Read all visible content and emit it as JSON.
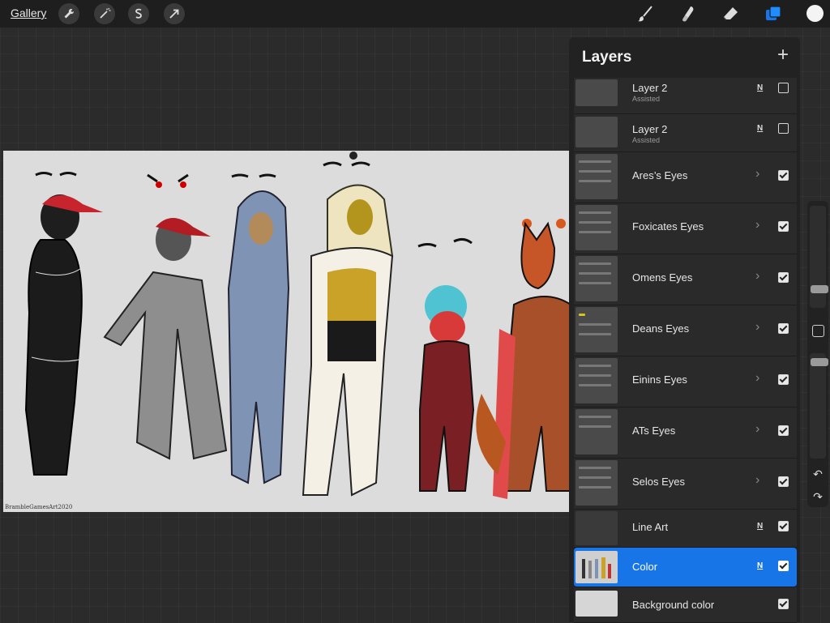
{
  "toolbar": {
    "gallery_label": "Gallery",
    "left_icons": [
      "wrench-icon",
      "magic-wand-icon",
      "selection-s-icon",
      "transform-arrow-icon"
    ],
    "right_icons": [
      "brush-icon",
      "smudge-icon",
      "eraser-icon",
      "layers-icon"
    ],
    "current_color": "#f4f4f4"
  },
  "canvas": {
    "signature": "BrambleGamesArt2020"
  },
  "layers_panel": {
    "title": "Layers",
    "add_icon": "+",
    "layers": [
      {
        "name": "Layer 2",
        "sub": "Assisted",
        "mode": "N",
        "visible": false,
        "group": false
      },
      {
        "name": "Layer 2",
        "sub": "Assisted",
        "mode": "N",
        "visible": false,
        "group": false
      },
      {
        "name": "Ares’s Eyes",
        "sub": "",
        "mode": "",
        "visible": true,
        "group": true
      },
      {
        "name": "Foxicates Eyes",
        "sub": "",
        "mode": "",
        "visible": true,
        "group": true
      },
      {
        "name": "Omens Eyes",
        "sub": "",
        "mode": "",
        "visible": true,
        "group": true
      },
      {
        "name": "Deans Eyes",
        "sub": "",
        "mode": "",
        "visible": true,
        "group": true
      },
      {
        "name": "Einins Eyes",
        "sub": "",
        "mode": "",
        "visible": true,
        "group": true
      },
      {
        "name": "ATs Eyes",
        "sub": "",
        "mode": "",
        "visible": true,
        "group": true
      },
      {
        "name": "Selos Eyes",
        "sub": "",
        "mode": "",
        "visible": true,
        "group": true
      },
      {
        "name": "Line Art",
        "sub": "",
        "mode": "N",
        "visible": true,
        "group": false
      },
      {
        "name": "Color",
        "sub": "",
        "mode": "N",
        "visible": true,
        "group": false,
        "active": true
      },
      {
        "name": "Background color",
        "sub": "",
        "mode": "",
        "visible": true,
        "group": false
      }
    ]
  },
  "colors": {
    "accent": "#1775e8",
    "panel_bg": "#222222",
    "toolbar_bg": "#1e1e1e"
  }
}
